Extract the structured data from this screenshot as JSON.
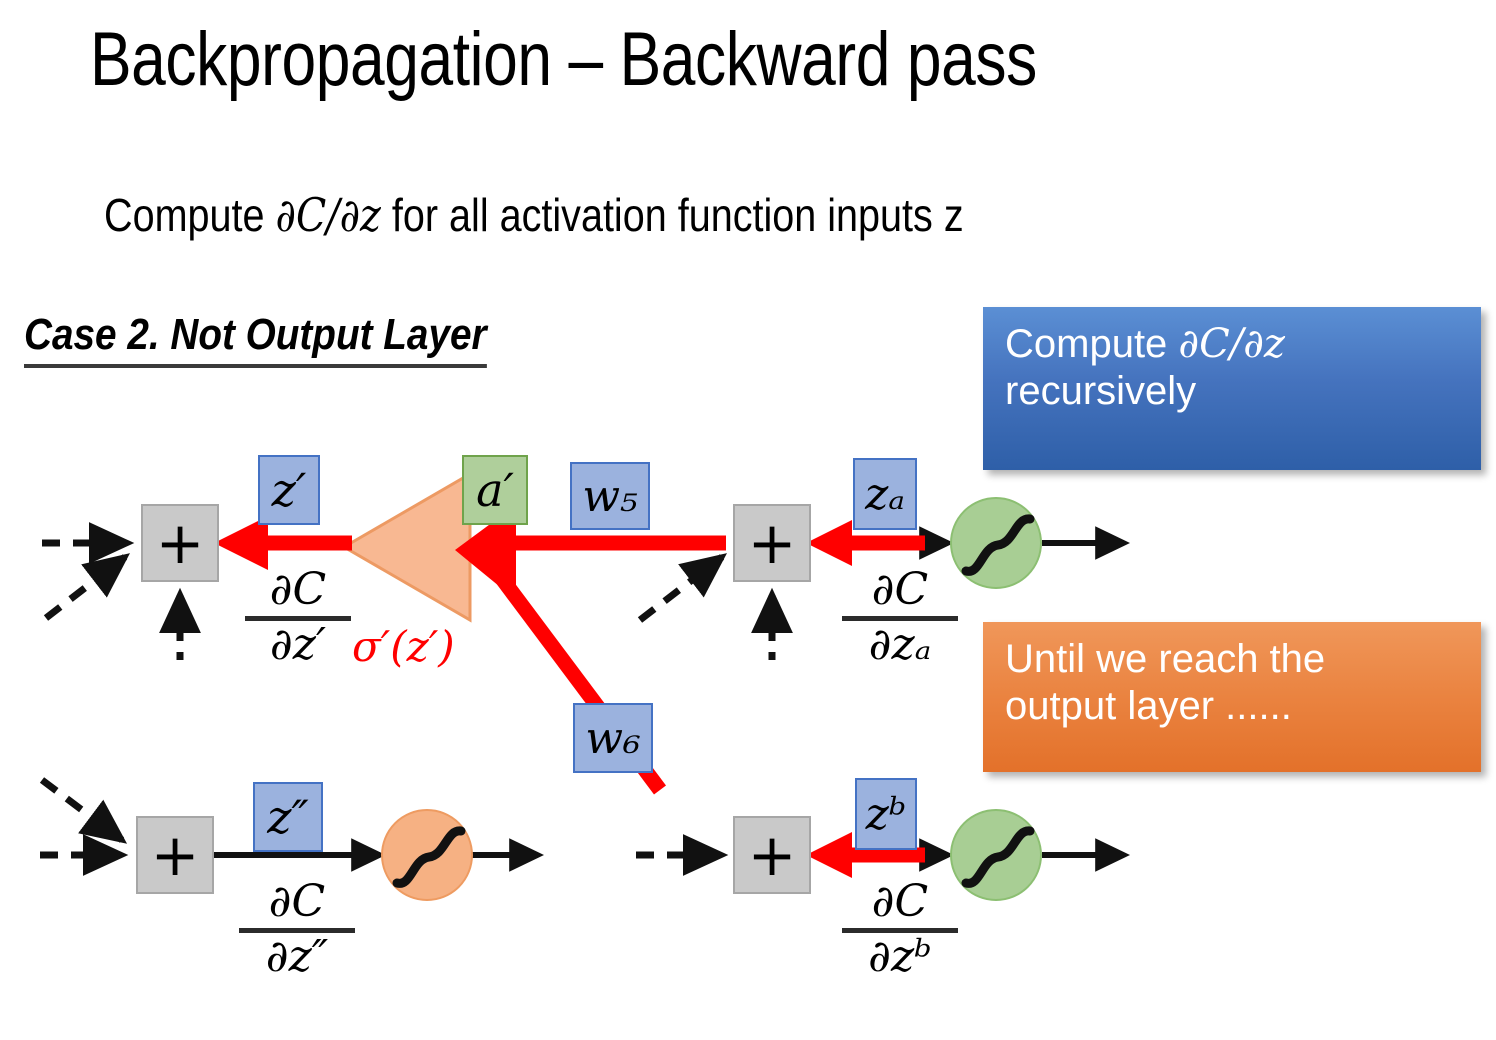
{
  "slide": {
    "title": "Backpropagation – Backward pass",
    "subtitle_prefix": "Compute ",
    "subtitle_math": "∂C/∂z",
    "subtitle_suffix": " for all activation function inputs z",
    "case_heading": "Case 2. Not Output Layer"
  },
  "callouts": {
    "blue": {
      "line1_prefix": "Compute ",
      "line1_math": "∂C/∂z",
      "line2": "recursively",
      "color": "#4573BE"
    },
    "orange": {
      "line1": "Until we reach the",
      "line2": "output layer ......",
      "color": "#EA8340"
    }
  },
  "diagram": {
    "nodes": {
      "sum_top_left": "+",
      "sum_top_right": "+",
      "sum_bottom_left": "+",
      "sum_bottom_right": "+"
    },
    "labels": {
      "z_prime": "z′",
      "a_prime": "a′",
      "w5": "w₅",
      "z_a": "zₐ",
      "z_double_prime": "z″",
      "w6": "w₆",
      "z_b": "zᵇ"
    },
    "fractions": {
      "dc_dzprime": {
        "num": "∂C",
        "den": "∂z′"
      },
      "dc_dza": {
        "num": "∂C",
        "den": "∂zₐ"
      },
      "dc_dzdoubleprime": {
        "num": "∂C",
        "den": "∂z″"
      },
      "dc_dzb": {
        "num": "∂C",
        "den": "∂zᵇ"
      }
    },
    "sigma_prime_label": "σ′(z′)",
    "colors": {
      "red_arrow": "#FF0000",
      "triangle_fill": "#F8B892",
      "triangle_stroke": "#ED9A63",
      "label_blue_fill": "#9BB2DE",
      "label_blue_stroke": "#4472C4",
      "label_green_fill": "#AFCF9B",
      "label_green_stroke": "#6FA34B",
      "sum_box_fill": "#C9C9C9",
      "neuron_green": "#A8CE94",
      "neuron_orange": "#F6B183"
    }
  }
}
